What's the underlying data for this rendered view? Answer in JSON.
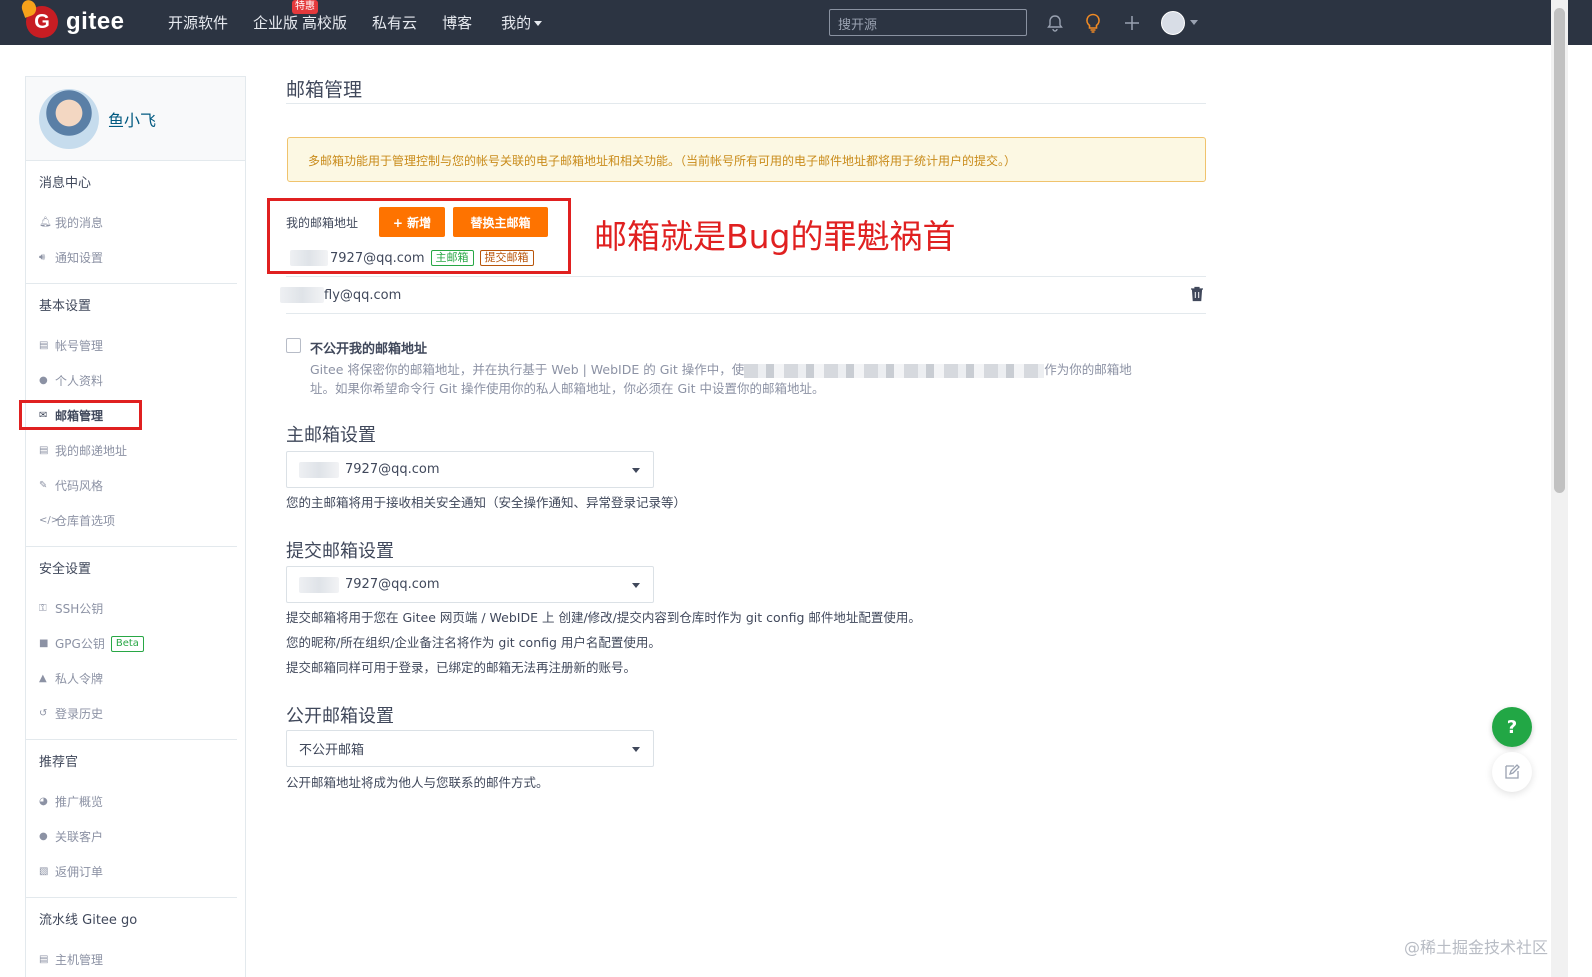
{
  "brand": {
    "logo_text": "gitee",
    "logo_letter": "G"
  },
  "nav": {
    "items": [
      "开源软件",
      "企业版",
      "高校版",
      "私有云",
      "博客",
      "我的"
    ],
    "badge": "特惠",
    "search_placeholder": "搜开源"
  },
  "sidebar": {
    "username": "鱼小飞",
    "sections": [
      {
        "title": "消息中心",
        "items": [
          "我的消息",
          "通知设置"
        ]
      },
      {
        "title": "基本设置",
        "items": [
          "帐号管理",
          "个人资料",
          "邮箱管理",
          "我的邮递地址",
          "代码风格",
          "仓库首选项"
        ]
      },
      {
        "title": "安全设置",
        "items": [
          "SSH公钥",
          "GPG公钥",
          "私人令牌",
          "登录历史"
        ]
      },
      {
        "title": "推荐官",
        "items": [
          "推广概览",
          "关联客户",
          "返佣订单"
        ]
      },
      {
        "title": "流水线 Gitee go",
        "items": [
          "主机管理"
        ]
      }
    ],
    "beta_label": "Beta"
  },
  "main": {
    "title": "邮箱管理",
    "notice": "多邮箱功能用于管理控制与您的帐号关联的电子邮箱地址和相关功能。（当前帐号所有可用的电子邮件地址都将用于统计用户的提交。）",
    "my_addresses_label": "我的邮箱地址",
    "add_button": "+ 新增",
    "replace_button": "替换主邮箱",
    "annotation": "邮箱就是Bug的罪魁祸首",
    "email1": "7927@qq.com",
    "tag_primary": "主邮箱",
    "tag_commit": "提交邮箱",
    "email2": "fly@qq.com",
    "private_checkbox_label": "不公开我的邮箱地址",
    "private_desc_1": "Gitee 将保密你的邮箱地址，并在执行基于 Web | WebIDE 的 Git 操作中，使",
    "private_desc_2": "作为你的邮箱地",
    "private_desc_3": "址。如果你希望命令行 Git 操作使用你的私人邮箱地址，你必须在 Git 中设置你的邮箱地址。",
    "primary_heading": "主邮箱设置",
    "primary_value": "7927@qq.com",
    "primary_help": "您的主邮箱将用于接收相关安全通知（安全操作通知、异常登录记录等）",
    "commit_heading": "提交邮箱设置",
    "commit_value": "7927@qq.com",
    "commit_help_1": "提交邮箱将用于您在 Gitee 网页端 / WebIDE 上 创建/修改/提交内容到仓库时作为 git config 邮件地址配置使用。",
    "commit_help_2": "您的昵称/所在组织/企业备注名将作为 git config 用户名配置使用。",
    "commit_help_3": "提交邮箱同样可用于登录，已绑定的邮箱无法再注册新的账号。",
    "public_heading": "公开邮箱设置",
    "public_value": "不公开邮箱",
    "public_help": "公开邮箱地址将成为他人与您联系的邮件方式。"
  },
  "float": {
    "help": "?"
  },
  "watermark": "@稀土掘金技术社区",
  "colors": {
    "nav_bg": "#2c3442",
    "accent_orange": "#fe7300",
    "annotation_red": "#e02020",
    "help_green": "#22a745"
  }
}
